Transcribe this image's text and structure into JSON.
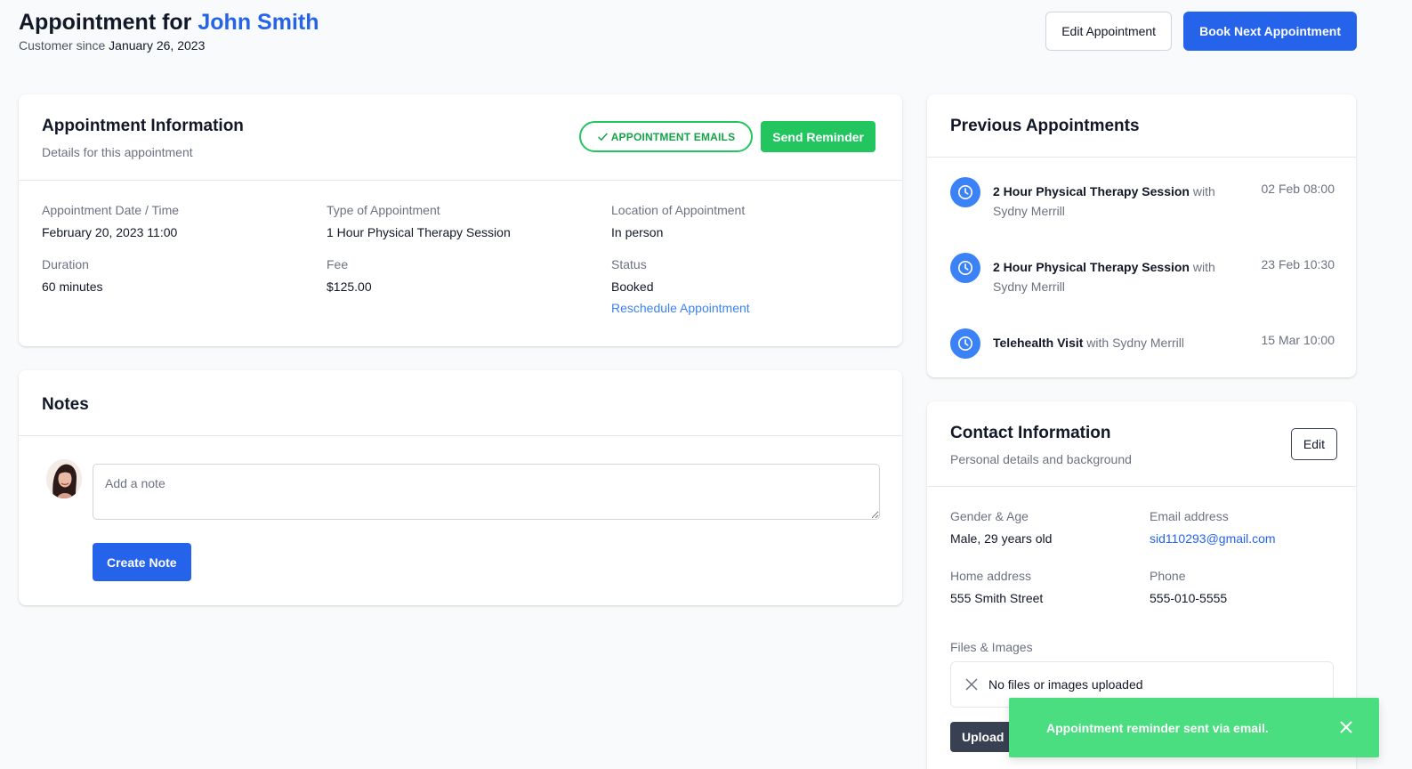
{
  "header": {
    "title_prefix": "Appointment for",
    "customer_name": "John Smith",
    "customer_since_label": "Customer since",
    "customer_since_date": "January 26, 2023",
    "edit_button": "Edit Appointment",
    "book_button": "Book Next Appointment"
  },
  "appointment": {
    "title": "Appointment Information",
    "subtitle": "Details for this appointment",
    "emails_badge": "APPOINTMENT EMAILS",
    "send_reminder": "Send Reminder",
    "fields": {
      "date_label": "Appointment Date / Time",
      "date_value": "February 20, 2023 11:00",
      "type_label": "Type of Appointment",
      "type_value": "1 Hour Physical Therapy Session",
      "location_label": "Location of Appointment",
      "location_value": "In person",
      "duration_label": "Duration",
      "duration_value": "60 minutes",
      "fee_label": "Fee",
      "fee_value": "$125.00",
      "status_label": "Status",
      "status_value": "Booked",
      "reschedule_link": "Reschedule Appointment"
    }
  },
  "notes": {
    "title": "Notes",
    "placeholder": "Add a note",
    "create_button": "Create Note"
  },
  "previous": {
    "title": "Previous Appointments",
    "items": [
      {
        "title": "2 Hour Physical Therapy Session",
        "with": "with Sydny Merrill",
        "date": "02 Feb 08:00"
      },
      {
        "title": "2 Hour Physical Therapy Session",
        "with": "with Sydny Merrill",
        "date": "23 Feb 10:30"
      },
      {
        "title": "Telehealth Visit",
        "with": "with Sydny Merrill",
        "date": "15 Mar 10:00"
      }
    ]
  },
  "contact": {
    "title": "Contact Information",
    "subtitle": "Personal details and background",
    "edit_button": "Edit",
    "gender_label": "Gender & Age",
    "gender_value": "Male, 29 years old",
    "email_label": "Email address",
    "email_value": "sid110293@gmail.com",
    "address_label": "Home address",
    "address_value": "555 Smith Street",
    "phone_label": "Phone",
    "phone_value": "555-010-5555",
    "files_label": "Files & Images",
    "files_empty": "No files or images uploaded",
    "upload_button": "Upload"
  },
  "toast": {
    "message": "Appointment reminder sent via email."
  },
  "colors": {
    "primary": "#2563eb",
    "success": "#22c55e",
    "toast": "#4ade80",
    "dark_button": "#374151"
  }
}
